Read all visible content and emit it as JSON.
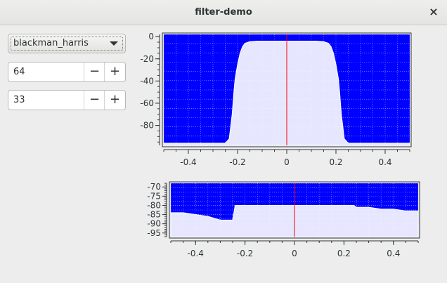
{
  "window": {
    "title": "filter-demo",
    "close_glyph": "×"
  },
  "controls": {
    "window_type": {
      "selected": "blackman_harris"
    },
    "taps": {
      "value": "64",
      "minus": "−",
      "plus": "+"
    },
    "cutoff": {
      "value": "33",
      "minus": "−",
      "plus": "+"
    }
  },
  "colors": {
    "plot_bg": "#0000ff",
    "trace": "#ffffff",
    "center_line": "#ff0000"
  },
  "chart_data": [
    {
      "type": "area",
      "title": "",
      "xlabel": "",
      "ylabel": "",
      "xlim": [
        -0.5,
        0.5
      ],
      "ylim": [
        -98,
        2
      ],
      "xticks": [
        -0.4,
        -0.2,
        0,
        0.2,
        0.4
      ],
      "xtick_labels": [
        "-0.4",
        "-0.2",
        "0",
        "0.2",
        "0.4"
      ],
      "yticks": [
        0,
        -20,
        -40,
        -60,
        -80
      ],
      "ytick_labels": [
        "0",
        "-20",
        "-40",
        "-60",
        "-80"
      ],
      "x": [
        -0.5,
        -0.25,
        -0.234,
        -0.222,
        -0.215,
        -0.21,
        -0.2,
        -0.19,
        -0.18,
        -0.17,
        -0.15,
        -0.12,
        0,
        0.12,
        0.15,
        0.17,
        0.18,
        0.19,
        0.2,
        0.21,
        0.215,
        0.222,
        0.234,
        0.25,
        0.5
      ],
      "y": [
        -96,
        -96,
        -92,
        -70,
        -50,
        -38,
        -25,
        -15,
        -9,
        -6,
        -4.5,
        -4,
        -4,
        -4,
        -4.5,
        -6,
        -9,
        -15,
        -25,
        -38,
        -50,
        -70,
        -92,
        -96,
        -96
      ],
      "grid": true
    },
    {
      "type": "area",
      "title": "",
      "xlabel": "",
      "ylabel": "",
      "xlim": [
        -0.5,
        0.5
      ],
      "ylim": [
        -97,
        -68
      ],
      "xticks": [
        -0.4,
        -0.2,
        0,
        0.2,
        0.4
      ],
      "xtick_labels": [
        "-0.4",
        "-0.2",
        "0",
        "0.2",
        "0.4"
      ],
      "yticks": [
        -70,
        -75,
        -80,
        -85,
        -90,
        -95
      ],
      "ytick_labels": [
        "-70",
        "-75",
        "-80",
        "-85",
        "-90",
        "-95"
      ],
      "x": [
        -0.5,
        -0.45,
        -0.4,
        -0.35,
        -0.3,
        -0.25,
        -0.24,
        -0.2,
        -0.16,
        -0.12,
        -0.08,
        -0.04,
        0,
        0.04,
        0.08,
        0.12,
        0.16,
        0.2,
        0.24,
        0.25,
        0.3,
        0.35,
        0.4,
        0.45,
        0.5
      ],
      "y": [
        -84,
        -84,
        -85,
        -86,
        -88,
        -88,
        -80,
        -80,
        -80,
        -80,
        -80,
        -80,
        -80,
        -80,
        -80,
        -80,
        -80,
        -80,
        -80,
        -81,
        -81,
        -82,
        -82,
        -83,
        -83
      ],
      "grid": true
    }
  ]
}
